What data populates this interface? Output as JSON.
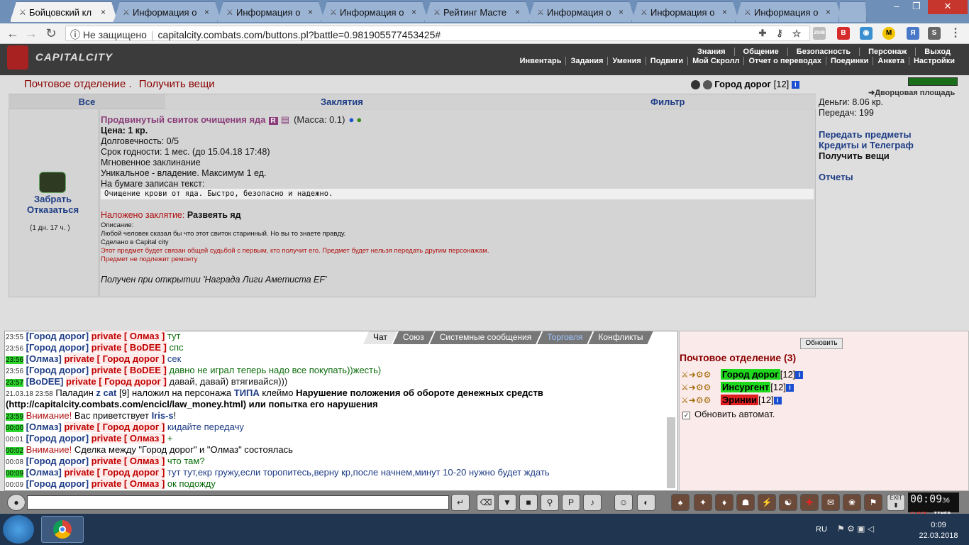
{
  "browser": {
    "tabs": [
      {
        "title": "Бойцовский кл",
        "active": true
      },
      {
        "title": "Информация о",
        "active": false
      },
      {
        "title": "Информация о",
        "active": false
      },
      {
        "title": "Информация о",
        "active": false
      },
      {
        "title": "Рейтинг Масте",
        "active": false
      },
      {
        "title": "Информация о",
        "active": false
      },
      {
        "title": "Информация о",
        "active": false
      },
      {
        "title": "Информация о",
        "active": false
      }
    ],
    "not_secure": "Не защищено",
    "url": "capitalcity.combats.com/buttons.pl?battle=0.981905577453425#",
    "ext_badge": "2048"
  },
  "game": {
    "logo": "CAPITALCITY",
    "menu_top": [
      "Знания",
      "Общение",
      "Безопасность",
      "Персонаж",
      "Выход"
    ],
    "menu_bottom": [
      "Инвентарь",
      "Задания",
      "Умения",
      "Подвиги",
      "Мой Скролл",
      "Отчет о переводах",
      "Поединки",
      "Анкета",
      "Настройки"
    ]
  },
  "page": {
    "title1": "Почтовое отделение .",
    "title2": "Получить вещи",
    "city": "Город дорог",
    "city_level": "[12]",
    "tabs": [
      "Все",
      "Заклятия",
      "Фильтр"
    ]
  },
  "item": {
    "take": "Забрать",
    "refuse": "Отказаться",
    "time_left": "(1 дн. 17 ч. )",
    "name": "Продвинутый свиток очищения яда",
    "badge": "R",
    "mass": "(Масса: 0.1)",
    "price": "Цена: 1 кр.",
    "durability": "Долговечность: 0/5",
    "expiry": "Срок годности: 1 мес. (до 15.04.18 17:48)",
    "instant": "Мгновенное заклинание",
    "unique": "Уникальное - владение. Максимум 1 ед.",
    "paper_label": "На бумаге записан текст:",
    "paper_text": "Очищение крови от яда. Быстро, безопасно и надежно.",
    "spell_label": "Наложено заклятие:",
    "spell_name": "Развеять яд",
    "desc_label": "Описание:",
    "desc": "Любой человек сказал бы что этот свиток старинный. Но вы то знаете правду.",
    "made_in": "Сделано в Capital city",
    "bound": "Этот предмет будет связан общей судьбой с первым, кто получит его. Предмет будет нельзя передать другим персонажам.",
    "no_repair": "Предмет не подлежит ремонту",
    "received": "Получен при открытии 'Награда Лиги Аметиста EF'"
  },
  "sidebar": {
    "location": "Дворцовая площадь",
    "money": "Деньги: 8.06 кр.",
    "transfers": "Передач: 199",
    "links": [
      "Передать предметы",
      "Кредиты и Телеграф",
      "Получить вещи",
      "Отчеты"
    ]
  },
  "chat": {
    "tabs": [
      "Чат",
      "Союз",
      "Системные сообщения",
      "Торговля",
      "Конфликты"
    ],
    "lines": [
      {
        "ts": "23:55",
        "hl": false,
        "nick": "[Город дорог]",
        "priv": "private [ Олмаз ]",
        "msg": "тут",
        "cls": "msgg"
      },
      {
        "ts": "23:56",
        "hl": false,
        "nick": "[Город дорог]",
        "priv": "private [ BoDEE ]",
        "msg": "спс",
        "cls": "msgg"
      },
      {
        "ts": "23:56",
        "hl": true,
        "nick": "[Олмаз]",
        "priv": "private [ Город дорог ]",
        "msg": "сек",
        "cls": "msg"
      },
      {
        "ts": "23:56",
        "hl": false,
        "nick": "[Город дорог]",
        "priv": "private [ BoDEE ]",
        "msg": "давно не играл теперь надо все покупать))жесть)",
        "cls": "msgg"
      },
      {
        "ts": "23:57",
        "hl": true,
        "nick": "[BoDEE]",
        "priv": "private [ Город дорог ]",
        "msg": "давай, давай) втягивайся)))",
        "cls": "msgk"
      }
    ],
    "sys_ts": "21.03.18 23:58",
    "sys_text1": "Паладин",
    "sys_pal": "z cat",
    "sys_text2": "[9] наложил на персонажа",
    "sys_target": "ТИПА",
    "sys_text3": "клеймо",
    "sys_reason": "Нарушение положения об обороте денежных средств",
    "sys_reason2": "(http://capitalcity.combats.com/encicl/law_money.html) или попытка его нарушения",
    "greet_ts": "23:59",
    "attention": "Внимание!",
    "greet_text": "Вас приветствует",
    "greet_name": "Iris-s",
    "lines2": [
      {
        "ts": "00:00",
        "hl": true,
        "nick": "[Олмаз]",
        "priv": "private [ Город дорог ]",
        "msg": "кидайте передачу",
        "cls": "msg"
      },
      {
        "ts": "00:01",
        "hl": false,
        "nick": "[Город дорог]",
        "priv": "private [ Олмаз ]",
        "msg": "+",
        "cls": "msgg"
      }
    ],
    "deal_ts": "00:02",
    "deal_text": "Сделка между \"Город дорог\" и \"Олмаз\" состоялась",
    "lines3": [
      {
        "ts": "00:08",
        "hl": false,
        "nick": "[Город дорог]",
        "priv": "private [ Олмаз ]",
        "msg": "что там?",
        "cls": "msgg"
      },
      {
        "ts": "00:09",
        "hl": true,
        "nick": "[Олмаз]",
        "priv": "private [ Город дорог ]",
        "msg": "тут тут,екр гружу,если торопитесь,верну кр,после начнем,минут 10-20 нужно будет ждать",
        "cls": "msg"
      },
      {
        "ts": "00:09",
        "hl": false,
        "nick": "[Город дорог]",
        "priv": "private [ Олмаз ]",
        "msg": "ок подожду",
        "cls": "msgg"
      }
    ]
  },
  "online": {
    "refresh": "Обновить",
    "title": "Почтовое отделение (3)",
    "users": [
      {
        "name": "Город дорог",
        "level": "[12]",
        "bg": "#1ed81e"
      },
      {
        "name": "Инсургент",
        "level": "[12]",
        "bg": "#1ed81e"
      },
      {
        "name": "Эринии",
        "level": "[12]",
        "bg": "#e02020"
      }
    ],
    "auto": "Обновить автомат."
  },
  "bottom": {
    "clock_time": "00:09",
    "clock_sec": "36",
    "clock_label": "CLOCK",
    "timer_label": "TIMER",
    "exit": "EXIT"
  },
  "taskbar": {
    "lang": "RU",
    "time": "0:09",
    "date": "22.03.2018"
  }
}
